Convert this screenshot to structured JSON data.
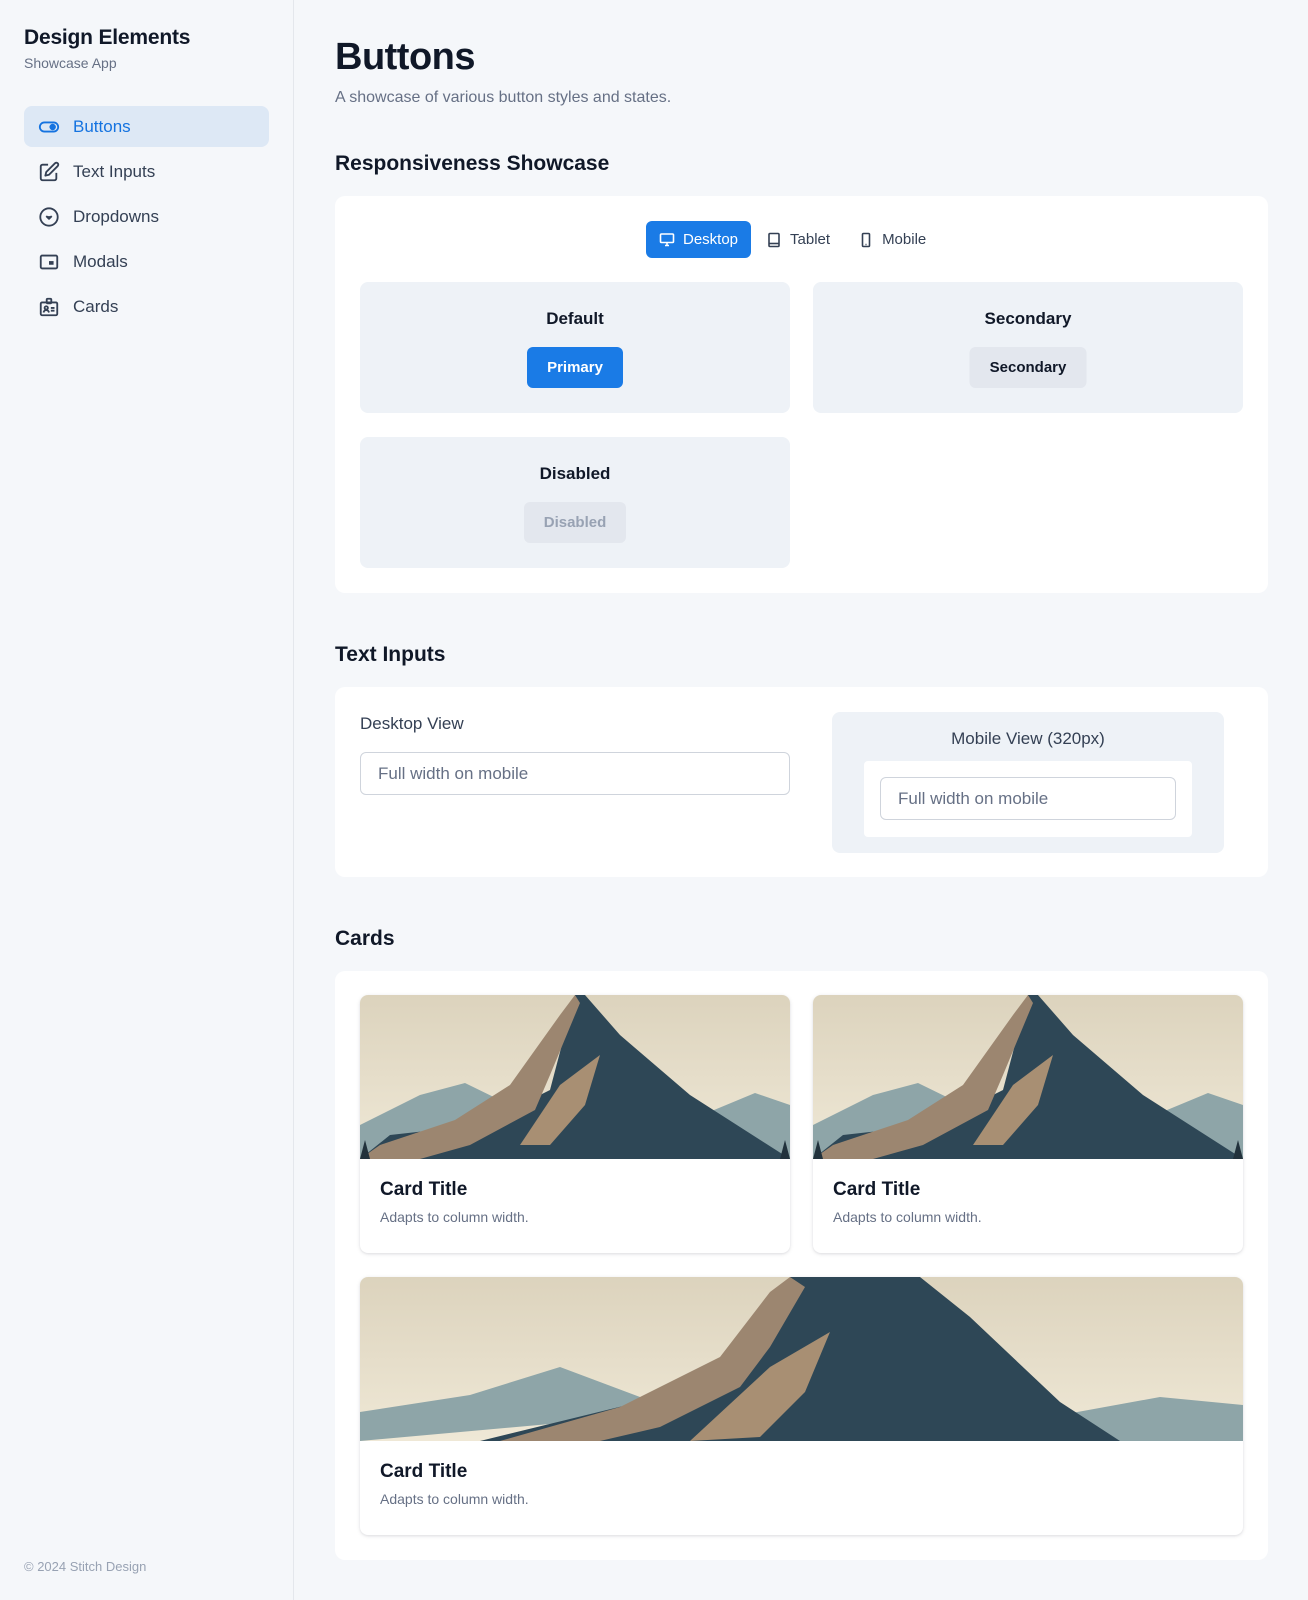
{
  "sidebar": {
    "title": "Design Elements",
    "subtitle": "Showcase App",
    "items": [
      {
        "label": "Buttons",
        "icon": "toggle-icon",
        "active": true
      },
      {
        "label": "Text Inputs",
        "icon": "edit-icon",
        "active": false
      },
      {
        "label": "Dropdowns",
        "icon": "chevron-circle-icon",
        "active": false
      },
      {
        "label": "Modals",
        "icon": "window-icon",
        "active": false
      },
      {
        "label": "Cards",
        "icon": "id-card-icon",
        "active": false
      }
    ],
    "footer": "© 2024 Stitch Design"
  },
  "page": {
    "title": "Buttons",
    "subtitle": "A showcase of various button styles and states."
  },
  "responsiveness": {
    "title": "Responsiveness Showcase",
    "tabs": [
      {
        "label": "Desktop",
        "icon": "monitor-icon",
        "active": true
      },
      {
        "label": "Tablet",
        "icon": "tablet-icon",
        "active": false
      },
      {
        "label": "Mobile",
        "icon": "phone-icon",
        "active": false
      }
    ],
    "demos": [
      {
        "label": "Default",
        "button": "Primary"
      },
      {
        "label": "Secondary",
        "button": "Secondary"
      },
      {
        "label": "Disabled",
        "button": "Disabled"
      }
    ]
  },
  "text_inputs": {
    "title": "Text Inputs",
    "desktop_label": "Desktop View",
    "desktop_placeholder": "Full width on mobile",
    "mobile_label": "Mobile View (320px)",
    "mobile_placeholder": "Full width on mobile"
  },
  "cards": {
    "title": "Cards",
    "items": [
      {
        "title": "Card Title",
        "text": "Adapts to column width.",
        "image": "mountain-image"
      },
      {
        "title": "Card Title",
        "text": "Adapts to column width.",
        "image": "mountain-image"
      },
      {
        "title": "Card Title",
        "text": "Adapts to column width.",
        "image": "mountain-image"
      }
    ]
  },
  "colors": {
    "accent": "#1a7be6",
    "active_nav_bg": "#dde8f5",
    "background": "#f5f7fa",
    "demo_box_bg": "#eef2f7"
  }
}
